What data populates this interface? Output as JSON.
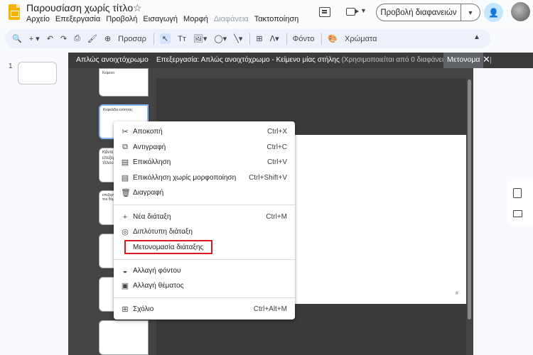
{
  "header": {
    "title": "Παρουσίαση χωρίς τίτλο",
    "menu": [
      "Αρχείο",
      "Επεξεργασία",
      "Προβολή",
      "Εισαγωγή",
      "Μορφή",
      "Διαφάνεια",
      "Τακτοποίηση"
    ],
    "present_label": "Προβολή διαφανειών"
  },
  "toolbar": {
    "zoom_label": "Προσαρ",
    "text_label": "Tт",
    "background_label": "Φόντο",
    "colors_label": "Χρώματα"
  },
  "filmstrip": {
    "slide_number": "1"
  },
  "editor": {
    "panel_title": "Απλώς ανοιχτόχρωμο",
    "title": "Επεξεργασία: Απλώς ανοιχτόχρωμο - Κείμενο μίας στήλης",
    "subtitle": "(Χρησιμοποιείται από 0 διαφάνειες)",
    "rename_tab": "Μετονομα",
    "page_num": "#"
  },
  "layout_thumbs": [
    {
      "text": "Κείμενο"
    },
    {
      "text": "Κεφαλίδα ενότητας"
    },
    {
      "text": "Κάντε κλικ για επεξεργασία του τίτλου"
    },
    {
      "text": "επεξεργασία της στήλης του θέματος"
    },
    {
      "text": ""
    },
    {
      "text": ""
    },
    {
      "text": ""
    },
    {
      "text": ""
    }
  ],
  "context_menu": {
    "items": [
      {
        "icon": "scissors-icon",
        "glyph": "✂",
        "label": "Αποκοπή",
        "shortcut": "Ctrl+X"
      },
      {
        "icon": "copy-icon",
        "glyph": "⧉",
        "label": "Αντιγραφή",
        "shortcut": "Ctrl+C"
      },
      {
        "icon": "paste-icon",
        "glyph": "📋",
        "label": "Επικόλληση",
        "shortcut": "Ctrl+V"
      },
      {
        "icon": "paste-plain-icon",
        "glyph": "📋",
        "label": "Επικόλληση χωρίς μορφοποίηση",
        "shortcut": "Ctrl+Shift+V"
      },
      {
        "icon": "trash-icon",
        "glyph": "🗑",
        "label": "Διαγραφή",
        "shortcut": ""
      },
      {
        "icon": "plus-icon",
        "glyph": "+",
        "label": "Νέα διάταξη",
        "shortcut": "Ctrl+M"
      },
      {
        "icon": "duplicate-icon",
        "glyph": "◎",
        "label": "Διπλότυπη διάταξη",
        "shortcut": ""
      },
      {
        "icon": "",
        "glyph": "",
        "label": "Μετονομασία διάταξης",
        "shortcut": ""
      },
      {
        "icon": "fill-drop-icon",
        "glyph": "◒",
        "label": "Αλλαγή φόντου",
        "shortcut": ""
      },
      {
        "icon": "theme-icon",
        "glyph": "▣",
        "label": "Αλλαγή θέματος",
        "shortcut": ""
      },
      {
        "icon": "add-comment-icon",
        "glyph": "⊞",
        "label": "Σχόλιο",
        "shortcut": "Ctrl+Alt+M"
      }
    ]
  }
}
